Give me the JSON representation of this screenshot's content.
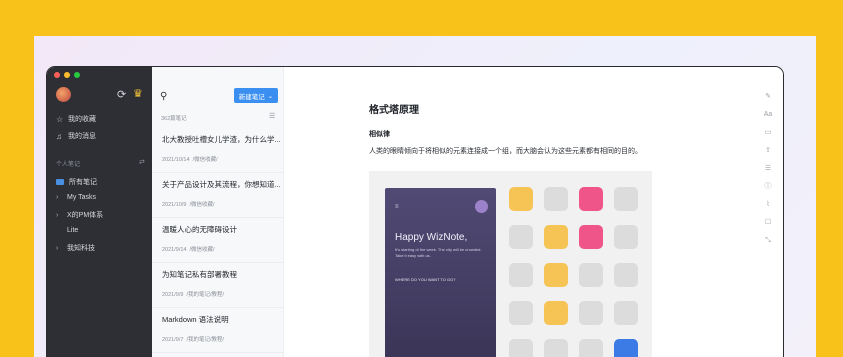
{
  "sidebar": {
    "favorites": "我的收藏",
    "messages": "我的消息",
    "section": "个人笔记",
    "folders": [
      {
        "label": "所有笔记",
        "chevron": ""
      },
      {
        "label": "My Tasks",
        "chevron": "›"
      },
      {
        "label": "X的PM体系",
        "chevron": "›"
      },
      {
        "label": "Lite",
        "chevron": ""
      },
      {
        "label": "我知科技",
        "chevron": "›"
      }
    ]
  },
  "list": {
    "new_button": "新建笔记",
    "count": "362篇笔记",
    "items": [
      {
        "title": "北大教授吐槽女儿学渣，为什么学...",
        "date": "2021/10/14",
        "folder": "/微信收藏/"
      },
      {
        "title": "关于产品设计及其流程，你想知道...",
        "date": "2021/10/9",
        "folder": "/微信收藏/"
      },
      {
        "title": "温暖人心的无障碍设计",
        "date": "2021/9/14",
        "folder": "/微信收藏/"
      },
      {
        "title": "为知笔记私有部署教程",
        "date": "2021/9/9",
        "folder": "/我的笔记/教程/"
      },
      {
        "title": "Markdown 语法说明",
        "date": "2021/9/7",
        "folder": "/我的笔记/教程/"
      }
    ]
  },
  "doc": {
    "title": "格式塔原理",
    "subtitle": "相似律",
    "paragraph": "人类的眼睛倾向于将相似的元素连接成一个组，而大脑会认为这些元素都有相同的目的。"
  },
  "phone": {
    "menu_icon": "≡",
    "greeting": "Happy WizNote,",
    "message": "It's starting of the week. The city will be crowded. Take it easy with us.",
    "question": "WHERE DO YOU WANT TO GO?"
  },
  "colors": {
    "background": "#f9c21b",
    "sidebar": "#2d2f34",
    "accent": "#3a8ff0",
    "yellow_tile": "#f5c454",
    "pink_tile": "#f0558a",
    "blue_tile": "#3c7be6"
  },
  "grid_tiles": [
    "y",
    "g",
    "p",
    "g",
    "g",
    "y",
    "p",
    "g",
    "g",
    "y",
    "g",
    "g",
    "g",
    "y",
    "g",
    "g",
    "g",
    "g",
    "g",
    "b"
  ]
}
